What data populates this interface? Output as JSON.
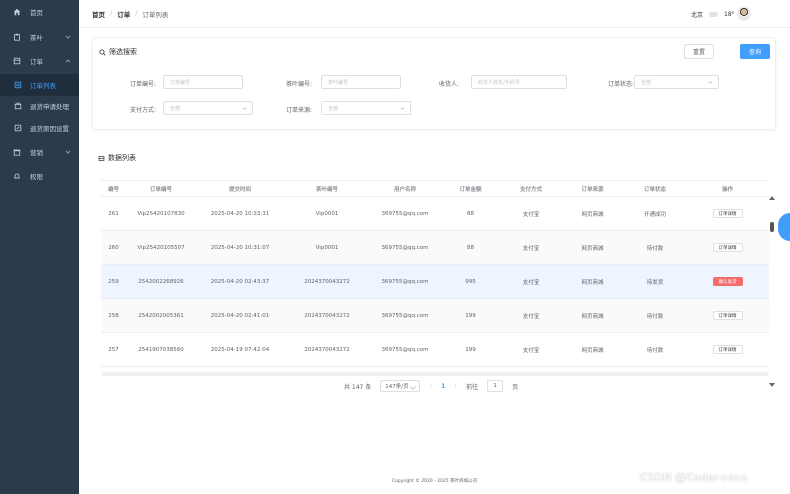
{
  "sidebar": {
    "items": [
      {
        "label": "首页",
        "icon": "home-icon"
      },
      {
        "label": "茶叶",
        "icon": "tea-icon",
        "expandable": true
      },
      {
        "label": "订单",
        "icon": "order-icon",
        "expandable": true
      },
      {
        "label": "订单列表",
        "icon": "list-icon",
        "active": true
      },
      {
        "label": "退货申请处理",
        "icon": "return-icon"
      },
      {
        "label": "退货原因设置",
        "icon": "edit-icon"
      },
      {
        "label": "营销",
        "icon": "marketing-icon",
        "expandable": true
      },
      {
        "label": "权限",
        "icon": "permission-icon"
      }
    ]
  },
  "header": {
    "breadcrumb": [
      "首页",
      "订单",
      "订单列表"
    ],
    "city": "北京",
    "temperature": "18°"
  },
  "filter": {
    "title": "筛选搜索",
    "reset_label": "重置",
    "query_label": "查询",
    "fields": [
      {
        "label": "订单编号:",
        "placeholder": "订单编号"
      },
      {
        "label": "茶叶编号:",
        "placeholder": "茶叶编号"
      },
      {
        "label": "收货人:",
        "placeholder": "收货人姓名/手机号"
      },
      {
        "label": "订单状态:",
        "placeholder": "全部"
      },
      {
        "label": "支付方式:",
        "placeholder": "全部"
      },
      {
        "label": "订单来源:",
        "placeholder": "全部"
      }
    ]
  },
  "table": {
    "title": "数据列表",
    "columns": [
      "编号",
      "订单编号",
      "提交时间",
      "茶叶编号",
      "用户名称",
      "订单金额",
      "支付方式",
      "订单来源",
      "订单状态",
      "操作"
    ],
    "rows": [
      {
        "id": "261",
        "order_no": "Vip25420107830",
        "time": "2025-04-20 10:33:31",
        "tea_no": "Vip0001",
        "user": "369755@qq.com",
        "amount": "88",
        "pay": "支付宝",
        "source": "网页商城",
        "status": "开通成功",
        "action": "订单详情"
      },
      {
        "id": "260",
        "order_no": "Vip25420105507",
        "time": "2025-04-20 10:31:07",
        "tea_no": "Vip0001",
        "user": "369755@qq.com",
        "amount": "88",
        "pay": "支付宝",
        "source": "网页商城",
        "status": "待付款",
        "action": "订单详情"
      },
      {
        "id": "259",
        "order_no": "2542002268926",
        "time": "2025-04-20 02:43:37",
        "tea_no": "2024370043272",
        "user": "369755@qq.com",
        "amount": "995",
        "pay": "支付宝",
        "source": "网页商城",
        "status": "待发货",
        "action": "确认发货"
      },
      {
        "id": "258",
        "order_no": "2542002005361",
        "time": "2025-04-20 02:41:01",
        "tea_no": "2024370043272",
        "user": "369755@qq.com",
        "amount": "199",
        "pay": "支付宝",
        "source": "网页商城",
        "status": "待付款",
        "action": "订单详情"
      },
      {
        "id": "257",
        "order_no": "2541907038560",
        "time": "2025-04-19 07:42:04",
        "tea_no": "2024370043272",
        "user": "369755@qq.com",
        "amount": "199",
        "pay": "支付宝",
        "source": "网页商城",
        "status": "待付款",
        "action": "订单详情"
      }
    ]
  },
  "pagination": {
    "total_text": "共 147 条",
    "page_size": "147条/页",
    "prev": "‹",
    "current_page": "1",
    "next": "›",
    "jump_label": "前往",
    "jump_value": "1",
    "page_suffix": "页"
  },
  "footer": {
    "copyright": "Copyright © 2020 - 2025  茶叶商城公司"
  },
  "watermark": "CSDN @Coder-coco",
  "colors": {
    "accent": "#409eff",
    "sidebar": "#2b3a4d",
    "danger": "#f56c6c"
  }
}
